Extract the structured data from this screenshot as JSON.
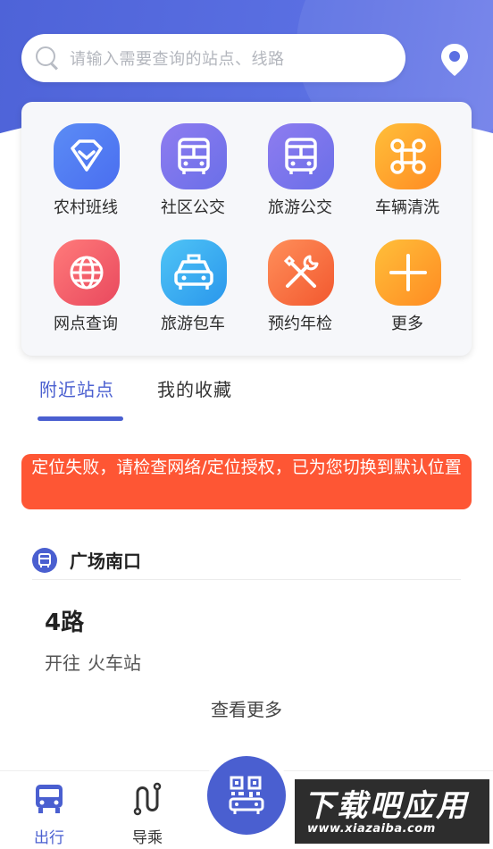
{
  "search": {
    "placeholder": "请输入需要查询的站点、线路"
  },
  "services": [
    {
      "label": "农村班线",
      "icon": "diamond-badge-icon",
      "colors": [
        "#5b8cf5",
        "#4a6ef0"
      ]
    },
    {
      "label": "社区公交",
      "icon": "bus-icon",
      "colors": [
        "#8e7cf0",
        "#6a6fe8"
      ]
    },
    {
      "label": "旅游公交",
      "icon": "bus-icon",
      "colors": [
        "#8e7cf0",
        "#6a6fe8"
      ]
    },
    {
      "label": "车辆清洗",
      "icon": "command-loop-icon",
      "colors": [
        "#ffbf3a",
        "#ff8b22"
      ]
    },
    {
      "label": "网点查询",
      "icon": "globe-icon",
      "colors": [
        "#ff7a7a",
        "#e9495e"
      ]
    },
    {
      "label": "旅游包车",
      "icon": "taxi-icon",
      "colors": [
        "#4fc4f6",
        "#2a97ec"
      ]
    },
    {
      "label": "预约年检",
      "icon": "tools-icon",
      "colors": [
        "#ff8f5a",
        "#f2582f"
      ]
    },
    {
      "label": "更多",
      "icon": "plus-icon",
      "colors": [
        "#ffbf3a",
        "#ff8b22"
      ]
    }
  ],
  "tabs": [
    {
      "label": "附近站点",
      "active": true
    },
    {
      "label": "我的收藏",
      "active": false
    }
  ],
  "alert": {
    "text": "定位失败，请检查网络/定位授权，已为您切换到默认位置",
    "color": "#fe5634"
  },
  "station": {
    "name": "广场南口"
  },
  "route": {
    "name": "4路",
    "direction": "开往",
    "destination": "火车站"
  },
  "more_label": "查看更多",
  "nav": [
    {
      "label": "出行",
      "icon": "bus-front-icon",
      "active": true
    },
    {
      "label": "导乘",
      "icon": "route-icon",
      "active": false
    }
  ],
  "watermark": {
    "title": "下载吧应用",
    "url": "www.xiazaiba.com"
  },
  "accent_color": "#4a5fd0"
}
